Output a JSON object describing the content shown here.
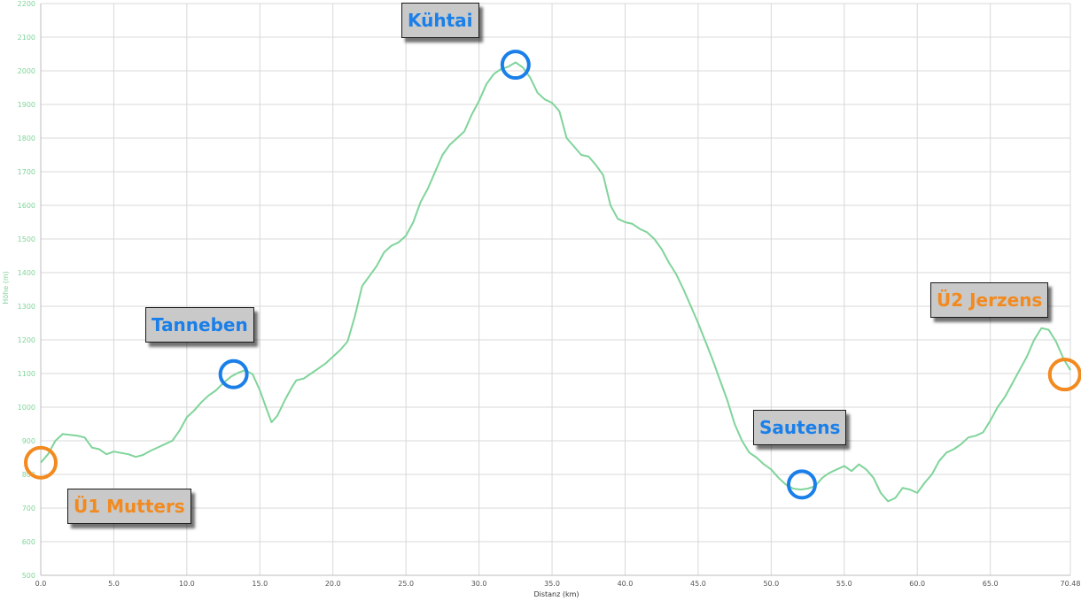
{
  "chart_data": {
    "type": "area",
    "xlabel": "Distanz (km)",
    "ylabel": "Höhe (m)",
    "xlim": [
      0,
      70.48
    ],
    "ylim": [
      500,
      2200
    ],
    "x_ticks": [
      "0.0",
      "5.0",
      "10.0",
      "15.0",
      "20.0",
      "25.0",
      "30.0",
      "35.0",
      "40.0",
      "45.0",
      "50.0",
      "55.0",
      "60.0",
      "65.0",
      "70.48"
    ],
    "y_ticks": [
      "500",
      "600",
      "700",
      "800",
      "900",
      "1000",
      "1100",
      "1200",
      "1300",
      "1400",
      "1500",
      "1600",
      "1700",
      "1800",
      "1900",
      "2000",
      "2100",
      "2200"
    ],
    "grid": true,
    "series": [
      {
        "color": "#7fd49a",
        "points": [
          [
            0,
            835
          ],
          [
            0.5,
            860
          ],
          [
            1,
            900
          ],
          [
            1.5,
            920
          ],
          [
            2.5,
            915
          ],
          [
            3,
            910
          ],
          [
            3.5,
            880
          ],
          [
            4,
            875
          ],
          [
            4.5,
            860
          ],
          [
            5,
            868
          ],
          [
            6,
            860
          ],
          [
            6.5,
            852
          ],
          [
            7,
            858
          ],
          [
            7.5,
            870
          ],
          [
            8,
            880
          ],
          [
            8.5,
            890
          ],
          [
            9,
            900
          ],
          [
            9.5,
            930
          ],
          [
            10,
            970
          ],
          [
            10.5,
            990
          ],
          [
            11,
            1015
          ],
          [
            11.5,
            1035
          ],
          [
            12,
            1050
          ],
          [
            12.5,
            1072
          ],
          [
            13,
            1090
          ],
          [
            13.5,
            1102
          ],
          [
            14,
            1110
          ],
          [
            14.5,
            1098
          ],
          [
            15,
            1050
          ],
          [
            15.5,
            990
          ],
          [
            15.8,
            955
          ],
          [
            16.2,
            975
          ],
          [
            16.7,
            1020
          ],
          [
            17.2,
            1060
          ],
          [
            17.5,
            1080
          ],
          [
            18,
            1085
          ],
          [
            18.5,
            1100
          ],
          [
            19,
            1115
          ],
          [
            19.5,
            1130
          ],
          [
            20,
            1150
          ],
          [
            20.5,
            1170
          ],
          [
            21,
            1195
          ],
          [
            21.5,
            1270
          ],
          [
            22,
            1360
          ],
          [
            22.5,
            1390
          ],
          [
            23,
            1420
          ],
          [
            23.5,
            1460
          ],
          [
            24,
            1480
          ],
          [
            24.5,
            1490
          ],
          [
            25,
            1510
          ],
          [
            25.5,
            1550
          ],
          [
            26,
            1610
          ],
          [
            26.5,
            1650
          ],
          [
            27,
            1700
          ],
          [
            27.5,
            1750
          ],
          [
            28,
            1780
          ],
          [
            28.5,
            1800
          ],
          [
            29,
            1820
          ],
          [
            29.5,
            1870
          ],
          [
            30,
            1910
          ],
          [
            30.5,
            1960
          ],
          [
            31,
            1990
          ],
          [
            31.5,
            2005
          ],
          [
            32,
            2012
          ],
          [
            32.5,
            2025
          ],
          [
            33,
            2010
          ],
          [
            33.5,
            1980
          ],
          [
            34,
            1935
          ],
          [
            34.5,
            1915
          ],
          [
            35,
            1905
          ],
          [
            35.5,
            1880
          ],
          [
            36,
            1800
          ],
          [
            36.5,
            1775
          ],
          [
            37,
            1750
          ],
          [
            37.5,
            1745
          ],
          [
            38,
            1720
          ],
          [
            38.5,
            1690
          ],
          [
            39,
            1600
          ],
          [
            39.5,
            1560
          ],
          [
            40,
            1550
          ],
          [
            40.5,
            1545
          ],
          [
            41,
            1530
          ],
          [
            41.5,
            1520
          ],
          [
            42,
            1500
          ],
          [
            42.5,
            1470
          ],
          [
            43,
            1430
          ],
          [
            43.5,
            1395
          ],
          [
            44,
            1350
          ],
          [
            44.5,
            1300
          ],
          [
            45,
            1250
          ],
          [
            45.5,
            1195
          ],
          [
            46,
            1140
          ],
          [
            46.5,
            1080
          ],
          [
            47,
            1020
          ],
          [
            47.5,
            950
          ],
          [
            48,
            900
          ],
          [
            48.5,
            865
          ],
          [
            49,
            850
          ],
          [
            49.5,
            830
          ],
          [
            50,
            815
          ],
          [
            50.5,
            790
          ],
          [
            51,
            770
          ],
          [
            51.5,
            758
          ],
          [
            52,
            755
          ],
          [
            52.5,
            758
          ],
          [
            53,
            765
          ],
          [
            53.5,
            790
          ],
          [
            54,
            805
          ],
          [
            54.5,
            815
          ],
          [
            55,
            825
          ],
          [
            55.5,
            810
          ],
          [
            56,
            830
          ],
          [
            56.5,
            815
          ],
          [
            57,
            790
          ],
          [
            57.5,
            745
          ],
          [
            58,
            720
          ],
          [
            58.5,
            730
          ],
          [
            59,
            760
          ],
          [
            59.5,
            755
          ],
          [
            60,
            745
          ],
          [
            60.5,
            775
          ],
          [
            61,
            800
          ],
          [
            61.5,
            840
          ],
          [
            62,
            865
          ],
          [
            62.5,
            875
          ],
          [
            63,
            890
          ],
          [
            63.5,
            910
          ],
          [
            64,
            915
          ],
          [
            64.5,
            925
          ],
          [
            65,
            960
          ],
          [
            65.5,
            1000
          ],
          [
            66,
            1030
          ],
          [
            66.5,
            1070
          ],
          [
            67,
            1110
          ],
          [
            67.5,
            1150
          ],
          [
            68,
            1200
          ],
          [
            68.5,
            1235
          ],
          [
            69,
            1230
          ],
          [
            69.5,
            1195
          ],
          [
            70,
            1145
          ],
          [
            70.48,
            1110
          ]
        ]
      }
    ],
    "annotations": [
      {
        "label": "Ü1 Mutters",
        "x": 0,
        "y": 835,
        "color": "#f28a1f"
      },
      {
        "label": "Tanneben",
        "x": 13.2,
        "y": 1098,
        "color": "#1a7fe8"
      },
      {
        "label": "Kühtai",
        "x": 32.5,
        "y": 2018,
        "color": "#1a7fe8"
      },
      {
        "label": "Sautens",
        "x": 52.1,
        "y": 770,
        "color": "#1a7fe8"
      },
      {
        "label": "Ü2 Jerzens",
        "x": 70.1,
        "y": 1097,
        "color": "#f28a1f"
      }
    ]
  },
  "colors": {
    "line": "#7fd49a",
    "grid": "#d8d8d8",
    "axis_text": "#7fd49a",
    "waypoint": "#1a7fe8",
    "station": "#f28a1f"
  }
}
